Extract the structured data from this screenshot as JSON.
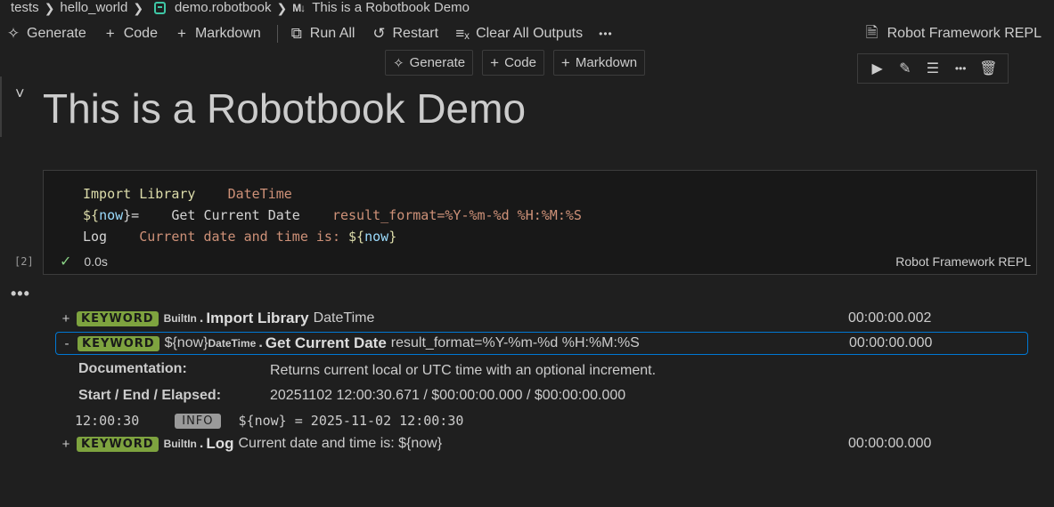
{
  "breadcrumb": {
    "items": [
      "tests",
      "hello_world",
      "demo.robotbook",
      "This is a Robotbook Demo"
    ],
    "md_icon": "M↓"
  },
  "toolbar": {
    "generate": "Generate",
    "code": "Code",
    "markdown": "Markdown",
    "run_all": "Run All",
    "restart": "Restart",
    "clear_outputs": "Clear All Outputs",
    "more": "•••",
    "kernel": "Robot Framework REPL"
  },
  "insert": {
    "generate": "Generate",
    "code": "Code",
    "markdown": "Markdown"
  },
  "markdown_cell": {
    "heading": "This is a Robotbook Demo"
  },
  "code_cell": {
    "line1": {
      "kw": "Import Library",
      "arg": "DateTime"
    },
    "line2": {
      "var_open": "${",
      "var_name": "now",
      "var_close": "}=",
      "kw": "Get Current Date",
      "arg": "result_format=%Y-%m-%d %H:%M:%S"
    },
    "line3": {
      "kw": "Log",
      "arg": "Current date and time is: ",
      "var_open": "${",
      "var_name": "now",
      "var_close": "}"
    },
    "exec_count": "[2]",
    "duration": "0.0s",
    "kernel": "Robot Framework REPL"
  },
  "output": {
    "rows": [
      {
        "toggle": "+",
        "badge": "KEYWORD",
        "lib": "BuiltIn",
        "name": "Import Library",
        "args": "DateTime",
        "elapsed": "00:00:00.002"
      },
      {
        "toggle": "-",
        "badge": "KEYWORD",
        "assign": "${now}",
        "lib": "DateTime",
        "name": "Get Current Date",
        "args": "result_format=%Y-%m-%d %H:%M:%S",
        "elapsed": "00:00:00.000"
      },
      {
        "toggle": "+",
        "badge": "KEYWORD",
        "lib": "BuiltIn",
        "name": "Log",
        "args": "Current date and time is: ${now}",
        "elapsed": "00:00:00.000"
      }
    ],
    "doc_label": "Documentation:",
    "doc_value": "Returns current local or UTC time with an optional increment.",
    "times_label": "Start / End / Elapsed:",
    "times_value": "20251102 12:00:30.671 / $00:00:00.000 / $00:00:00.000",
    "message": {
      "time": "12:00:30",
      "level": "INFO",
      "text": "${now} = 2025-11-02 12:00:30"
    }
  },
  "colors": {
    "accent": "#0078d4",
    "keyword_badge": "#7ea33f",
    "success": "#89d185"
  }
}
